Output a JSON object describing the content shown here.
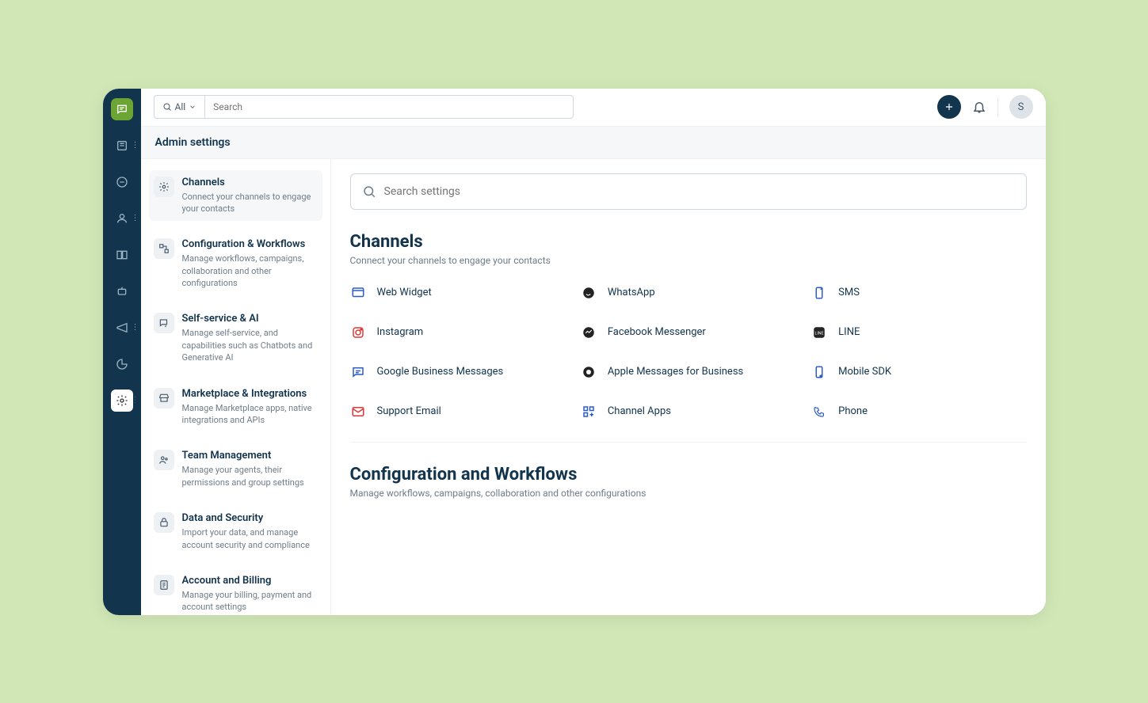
{
  "topbar": {
    "search_scope": "All",
    "search_placeholder": "Search",
    "avatar_initial": "S"
  },
  "subheader": "Admin settings",
  "sidebar": [
    {
      "title": "Channels",
      "desc": "Connect your channels to engage your contacts"
    },
    {
      "title": "Configuration & Workflows",
      "desc": "Manage workflows, campaigns, collaboration and other configurations"
    },
    {
      "title": "Self-service & AI",
      "desc": "Manage self-service, and capabilities such as Chatbots and Generative AI"
    },
    {
      "title": "Marketplace & Integrations",
      "desc": "Manage Marketplace apps, native integrations and APIs"
    },
    {
      "title": "Team Management",
      "desc": "Manage your agents, their permissions and group settings"
    },
    {
      "title": "Data and Security",
      "desc": "Import your data, and manage account security and compliance"
    },
    {
      "title": "Account and Billing",
      "desc": "Manage your billing, payment and account settings"
    }
  ],
  "settings_search_placeholder": "Search settings",
  "section1": {
    "title": "Channels",
    "desc": "Connect your channels to engage your contacts"
  },
  "channels": [
    "Web Widget",
    "WhatsApp",
    "SMS",
    "Instagram",
    "Facebook Messenger",
    "LINE",
    "Google Business Messages",
    "Apple Messages for Business",
    "Mobile SDK",
    "Support Email",
    "Channel Apps",
    "Phone"
  ],
  "section2": {
    "title": "Configuration and Workflows",
    "desc": "Manage workflows, campaigns, collaboration and other configurations"
  }
}
